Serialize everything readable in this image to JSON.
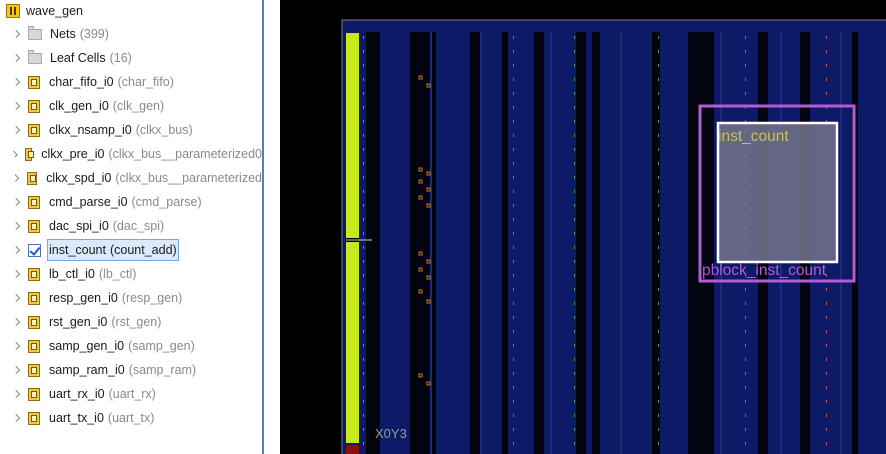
{
  "tree": {
    "root": {
      "label": "wave_gen",
      "icon": "design-icon"
    },
    "items": [
      {
        "name": "Nets",
        "type": "(399)",
        "icon": "folder-icon",
        "selected": false
      },
      {
        "name": "Leaf Cells",
        "type": "(16)",
        "icon": "folder-icon",
        "selected": false
      },
      {
        "name": "char_fifo_i0",
        "type": "(char_fifo)",
        "icon": "cell-icon",
        "selected": false
      },
      {
        "name": "clk_gen_i0",
        "type": "(clk_gen)",
        "icon": "cell-icon",
        "selected": false
      },
      {
        "name": "clkx_nsamp_i0",
        "type": "(clkx_bus)",
        "icon": "cell-icon",
        "selected": false
      },
      {
        "name": "clkx_pre_i0",
        "type": "(clkx_bus__parameterized0",
        "icon": "cell-icon",
        "selected": false
      },
      {
        "name": "clkx_spd_i0",
        "type": "(clkx_bus__parameterized",
        "icon": "cell-icon",
        "selected": false
      },
      {
        "name": "cmd_parse_i0",
        "type": "(cmd_parse)",
        "icon": "cell-icon",
        "selected": false
      },
      {
        "name": "dac_spi_i0",
        "type": "(dac_spi)",
        "icon": "cell-icon",
        "selected": false
      },
      {
        "name": "inst_count",
        "type": "(count_add)",
        "icon": "checked-cell-icon",
        "selected": true
      },
      {
        "name": "lb_ctl_i0",
        "type": "(lb_ctl)",
        "icon": "cell-icon",
        "selected": false
      },
      {
        "name": "resp_gen_i0",
        "type": "(resp_gen)",
        "icon": "cell-icon",
        "selected": false
      },
      {
        "name": "rst_gen_i0",
        "type": "(rst_gen)",
        "icon": "cell-icon",
        "selected": false
      },
      {
        "name": "samp_gen_i0",
        "type": "(samp_gen)",
        "icon": "cell-icon",
        "selected": false
      },
      {
        "name": "samp_ram_i0",
        "type": "(samp_ram)",
        "icon": "cell-icon",
        "selected": false
      },
      {
        "name": "uart_rx_i0",
        "type": "(uart_rx)",
        "icon": "cell-icon",
        "selected": false
      },
      {
        "name": "uart_tx_i0",
        "type": "(uart_tx)",
        "icon": "cell-icon",
        "selected": false
      }
    ]
  },
  "device": {
    "clock_region_label": "X0Y3",
    "cell_label": "inst_count",
    "pblock_label": "pblock_inst_count",
    "colors": {
      "background": "#000000",
      "fabric": "#0d1a66",
      "io_column": "#c8e81e",
      "pblock": "#b35bd8",
      "cell_box": "#ffffff",
      "cell_label": "#c9c24e",
      "region_border": "#7a7a7a"
    }
  }
}
